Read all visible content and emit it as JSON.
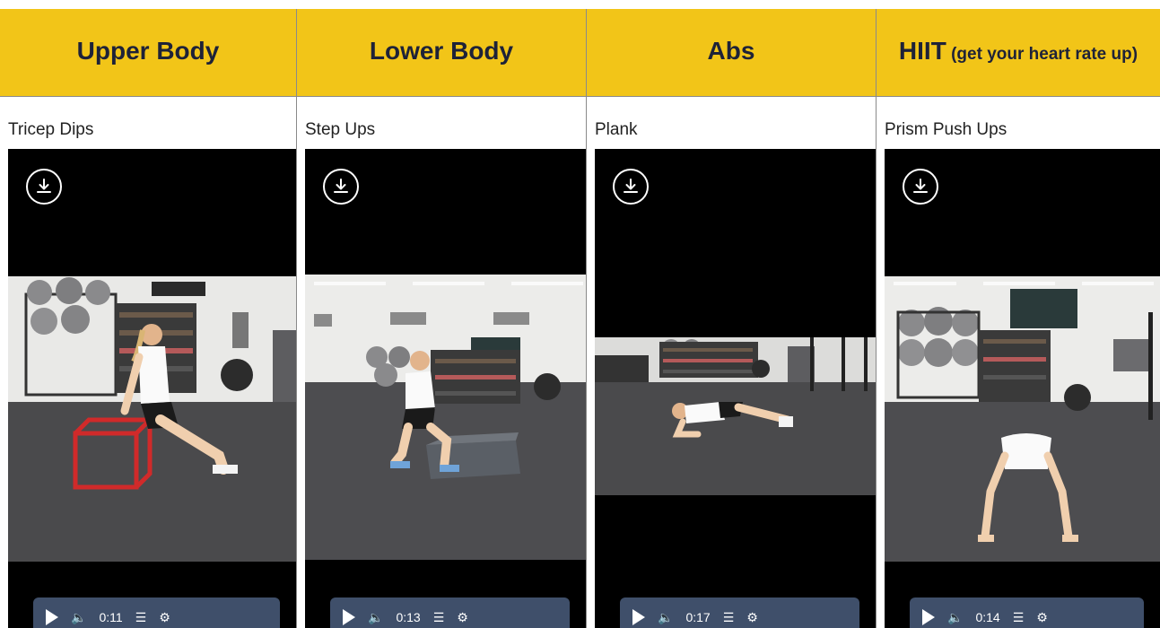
{
  "columns": [
    {
      "header_main": "Upper Body",
      "header_small": "",
      "exercise": "Tricep Dips",
      "time": "0:11"
    },
    {
      "header_main": "Lower Body",
      "header_small": "",
      "exercise": "Step Ups",
      "time": "0:13"
    },
    {
      "header_main": "Abs",
      "header_small": "",
      "exercise": "Plank",
      "time": "0:17"
    },
    {
      "header_main": "HIIT",
      "header_small": " (get your heart rate up)",
      "exercise": "Prism Push Ups",
      "time": "0:14"
    }
  ],
  "colors": {
    "header_bg": "#f2c518",
    "header_text": "#1e2238",
    "video_bg": "#000000",
    "controls_bg": "#3f4f6a"
  },
  "icons": {
    "download": "download-icon",
    "play": "play-icon",
    "volume": "volume-icon",
    "quality": "quality-icon",
    "settings": "gear-icon"
  }
}
